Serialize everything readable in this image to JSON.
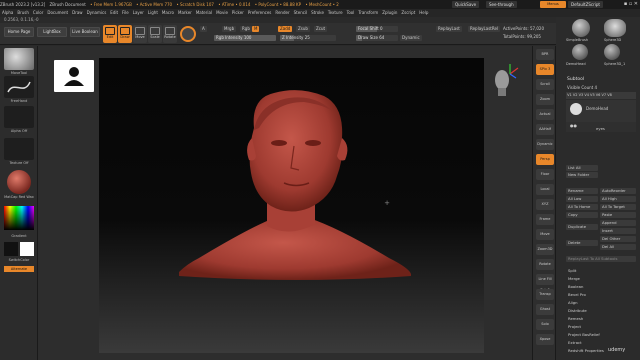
{
  "titlebar": {
    "items": [
      "ZBrush 2023.2 [v13.2]",
      "ZBrush Document",
      "• Free Mem 1.967GB",
      "• Active Mem 770",
      "• Scratch Disk 107",
      "• ATime • 0.014",
      "• PolyCount • 88.88 KP",
      "• MeshCount • 2"
    ],
    "quicksave": "QuickSave",
    "seethrough": "See-through",
    "menus_label": "Menus",
    "script": "DefaultZScript"
  },
  "menubar": {
    "items": [
      "Alpha",
      "Brush",
      "Color",
      "Document",
      "Draw",
      "Dynamics",
      "Edit",
      "File",
      "Layer",
      "Light",
      "Macro",
      "Marker",
      "Material",
      "Movie",
      "Picker",
      "Preferences",
      "Render",
      "Stencil",
      "Stroke",
      "Texture",
      "Tool",
      "Transform",
      "Zplugin",
      "Zscript",
      "Help"
    ]
  },
  "infoline": "0.2563, 0.1.16,-0",
  "toolshelf": {
    "home_page": "Home Page",
    "lightbox": "LightBox",
    "live_boolean": "Live Boolean",
    "tools": [
      {
        "label": "Edit",
        "active": true
      },
      {
        "label": "Draw",
        "active": true
      },
      {
        "label": "Move",
        "active": false
      },
      {
        "label": "Scale",
        "active": false
      },
      {
        "label": "Rotate",
        "active": false
      }
    ],
    "a_label": "A",
    "mrgb": "Mrgb",
    "rgb": "Rgb",
    "m": "M",
    "zadd": "Zadd",
    "zsub": "Zsub",
    "zcut": "Zcut",
    "rgb_intensity": {
      "label": "Rgb Intensity",
      "value": "100"
    },
    "z_intensity": {
      "label": "Z Intensity",
      "value": "25"
    },
    "focal_shift": {
      "label": "Focal Shift",
      "value": "0"
    },
    "draw_size": {
      "label": "Draw Size",
      "value": "64"
    },
    "dynamic": "Dynamic",
    "replay_last": "ReplayLast",
    "replay_last_rel": "ReplayLastRel",
    "active_points": "ActivePoints: 57,020",
    "total_points": "TotalPoints: 99,205"
  },
  "left_panel": {
    "brush": "MoveTool",
    "stroke": "FreeHand",
    "alpha": "Alpha Off",
    "texture": "Texture Off",
    "material": "MatCap Red Wax",
    "gradient": "Gradient",
    "switch_color": "SwitchColor",
    "alternate": "Alternate"
  },
  "right_shelf": [
    "BPR",
    "SPix 3",
    "Scroll",
    "Zoom",
    "Actual",
    "AAHalf",
    "Dynamic",
    "Persp",
    "Floor",
    "Local",
    "XYZ",
    "Frame",
    "Move",
    "Zoom3D",
    "Rotate",
    "Line Fill PolyF",
    "Transp",
    "Ghost",
    "Solo",
    "Xpose"
  ],
  "tray": {
    "thumbs": [
      "SimpleBrush",
      "Sphere3D",
      "Sphere3D_1",
      "DemoHead",
      "Cylinder3D"
    ],
    "subtool_title": "Subtool",
    "visible_count": "Visible Count 4",
    "subtools": [
      "DemoHead",
      "eyes"
    ],
    "list_all": "List All",
    "new_folder": "New Folder",
    "rename": "Rename",
    "autoreorder": "AutoReorder",
    "all_low": "All Low",
    "all_high": "All High",
    "all_to_home": "All To Home",
    "all_to_target": "All To Target",
    "copy": "Copy",
    "paste": "Paste",
    "duplicate": "Duplicate",
    "append": "Append",
    "insert": "Insert",
    "delete": "Delete",
    "del_other": "Del Other",
    "del_all": "Del All",
    "replay_last": "ReplayLast To All Subtools",
    "bottom": [
      "Split",
      "Merge",
      "Boolean",
      "Bevel Pro",
      "Align",
      "Distribute",
      "Remesh",
      "Project",
      "Project BasRelief",
      "Extract",
      "Redshift Properties"
    ]
  },
  "watermark": "udemy",
  "colors": {
    "accent": "#e8872a",
    "head": "#b5463a",
    "bg": "#2a2a2a"
  }
}
